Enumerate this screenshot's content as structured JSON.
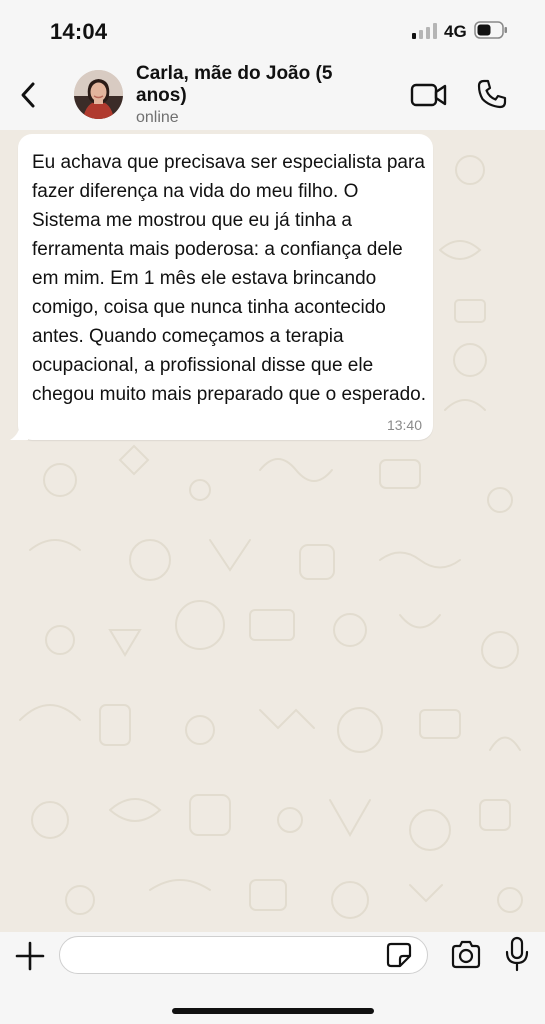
{
  "status_bar": {
    "time": "14:04",
    "network": "4G",
    "icons": [
      "signal-icon",
      "battery-icon"
    ]
  },
  "header": {
    "contact_name": "Carla, mãe do João (5 anos)",
    "contact_status": "online",
    "icons": [
      "back-arrow-icon",
      "avatar",
      "video-call-icon",
      "phone-icon"
    ]
  },
  "chat": {
    "messages": [
      {
        "direction": "incoming",
        "text": "Eu achava que precisava ser especialista para fazer diferença na vida do meu filho. O Sistema me mostrou que eu já tinha a ferramenta mais poderosa: a confiança dele em mim. Em 1 mês ele estava brincando comigo, coisa que nunca tinha acontecido antes. Quando começamos a terapia ocupacional, a profissional disse que ele chegou muito mais preparado que o esperado.",
        "time": "13:40"
      }
    ]
  },
  "input_bar": {
    "value": "",
    "icons": [
      "plus-icon",
      "sticker-icon",
      "camera-icon",
      "microphone-icon"
    ]
  },
  "colors": {
    "chat_background": "#efeae2",
    "bubble": "#ffffff",
    "bar_background": "#f6f6f6",
    "secondary_text": "#707070"
  }
}
